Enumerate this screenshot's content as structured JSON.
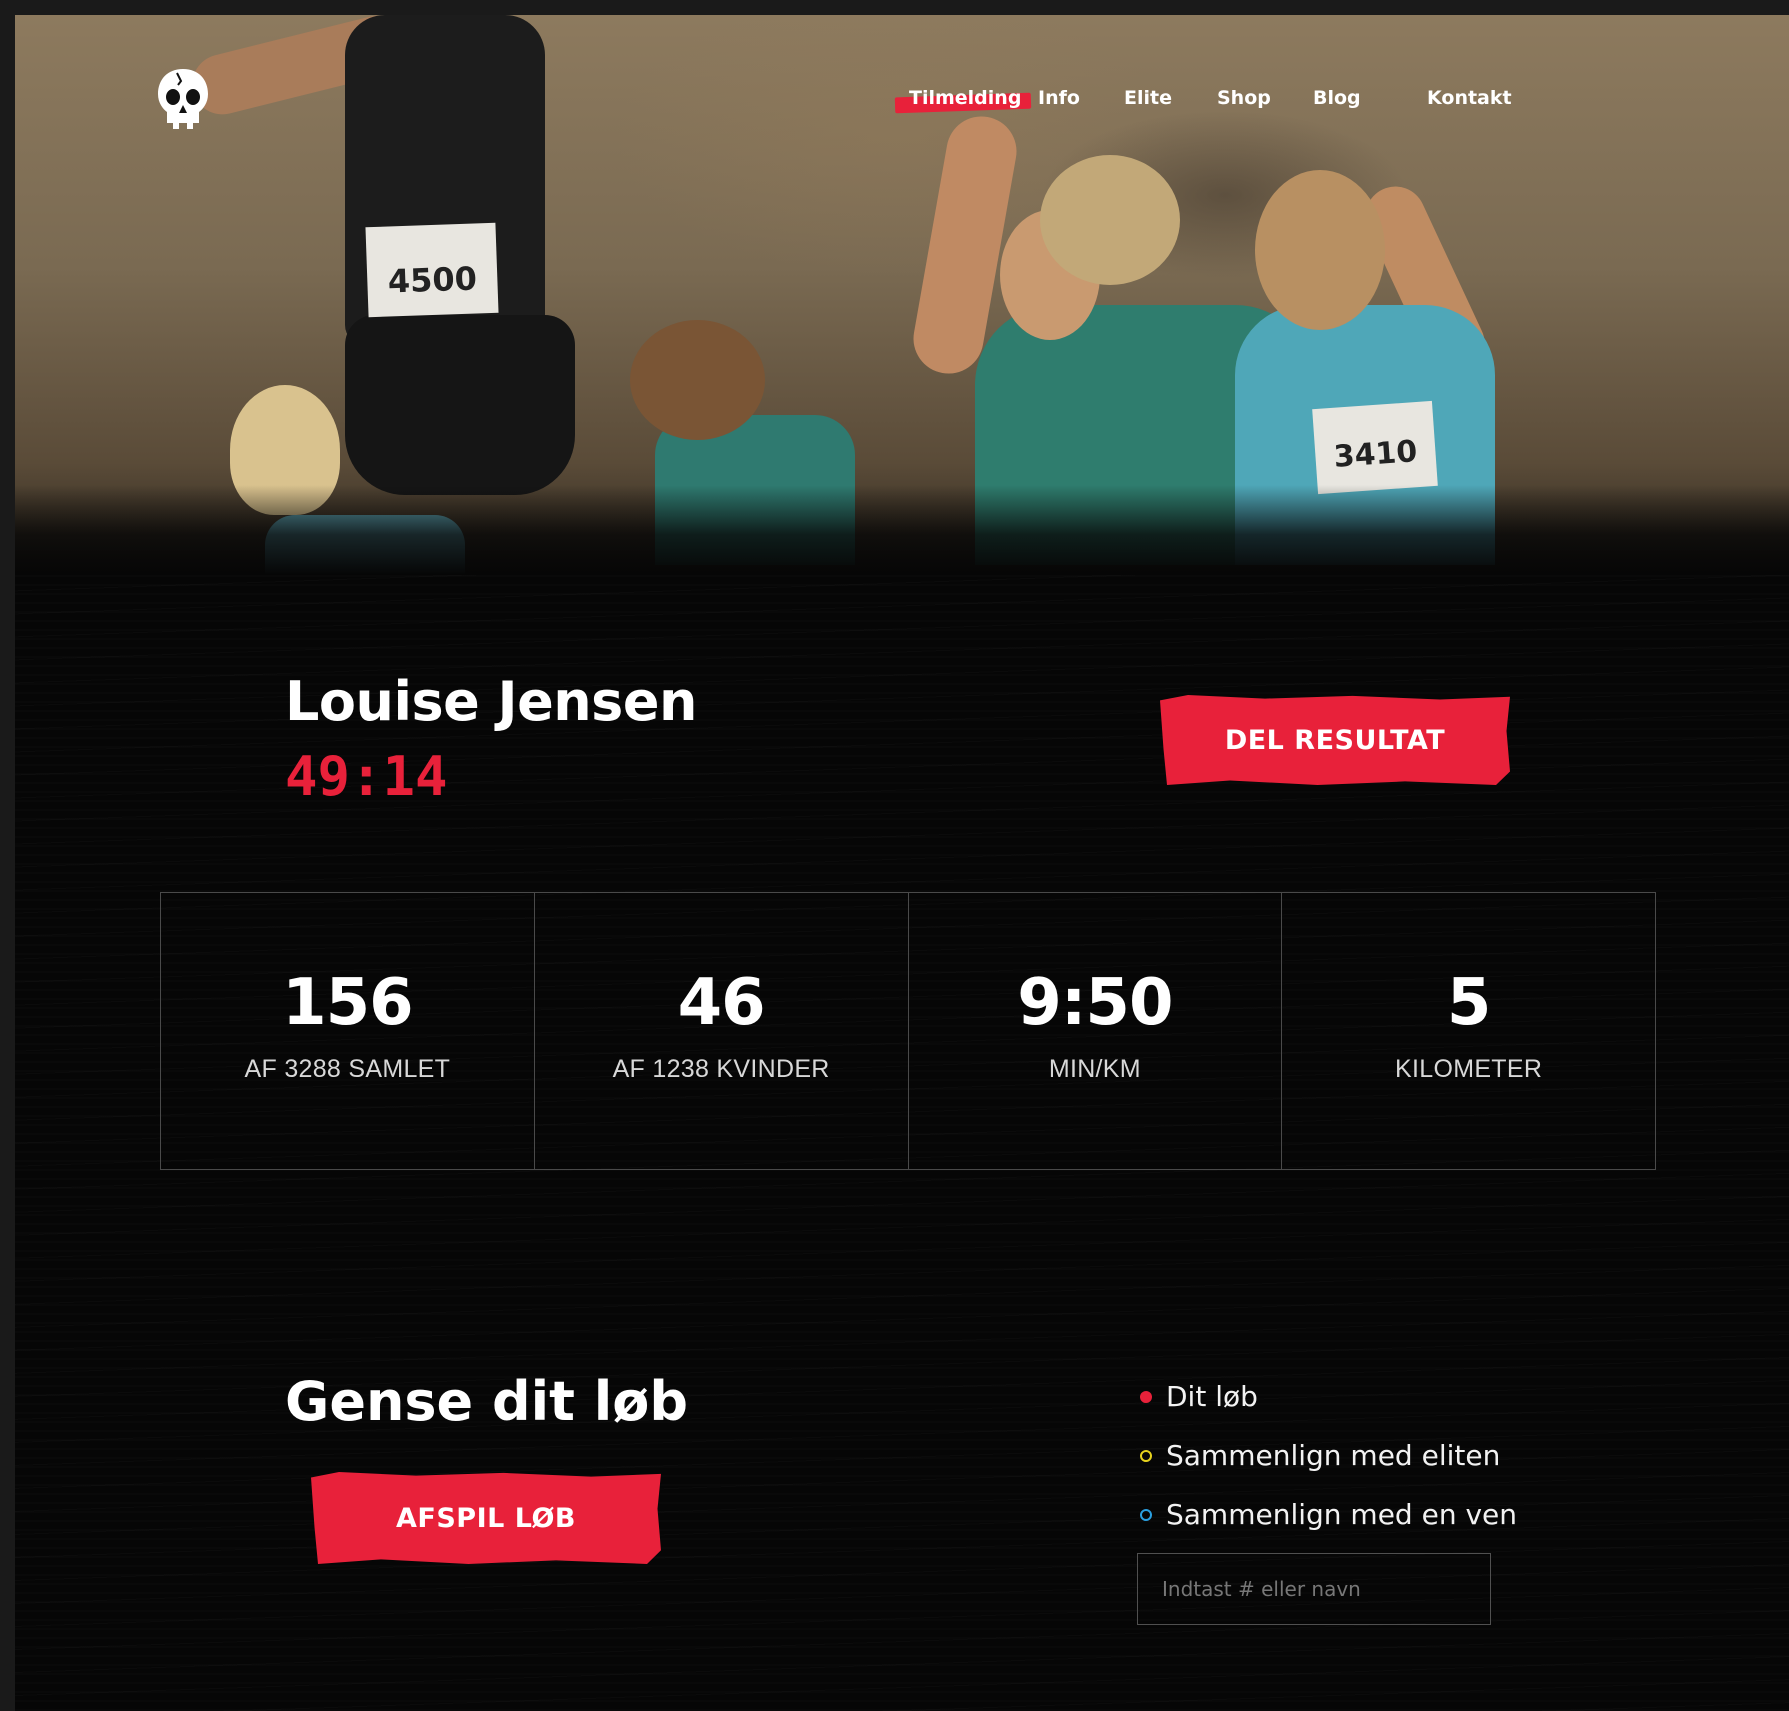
{
  "nav": {
    "items": [
      {
        "label": "Tilmelding",
        "active": true
      },
      {
        "label": "Info",
        "active": false
      },
      {
        "label": "Elite",
        "active": false
      },
      {
        "label": "Shop",
        "active": false
      },
      {
        "label": "Blog",
        "active": false
      },
      {
        "label": "Kontakt",
        "active": false
      }
    ]
  },
  "logo": {
    "icon": "skull-icon"
  },
  "hero": {
    "bibs": [
      "4500",
      "3410"
    ]
  },
  "result": {
    "name": "Louise Jensen",
    "time": "49:14",
    "share_label": "DEL RESULTAT"
  },
  "stats": [
    {
      "value": "156",
      "label": "AF 3288 SAMLET"
    },
    {
      "value": "46",
      "label": "AF 1238 KVINDER"
    },
    {
      "value": "9:50",
      "label": "MIN/KM"
    },
    {
      "value": "5",
      "label": "KILOMETER"
    }
  ],
  "replay": {
    "heading": "Gense dit løb",
    "play_label": "AFSPIL LØB",
    "legend": [
      {
        "label": "Dit løb",
        "color": "#e8213a",
        "filled": true
      },
      {
        "label": "Sammenlign med eliten",
        "color": "#e6d21e",
        "filled": false
      },
      {
        "label": "Sammenlign med en ven",
        "color": "#2a9fe0",
        "filled": false
      }
    ],
    "search_placeholder": "Indtast # eller navn"
  },
  "colors": {
    "accent": "#e8213a",
    "background": "#060606"
  }
}
